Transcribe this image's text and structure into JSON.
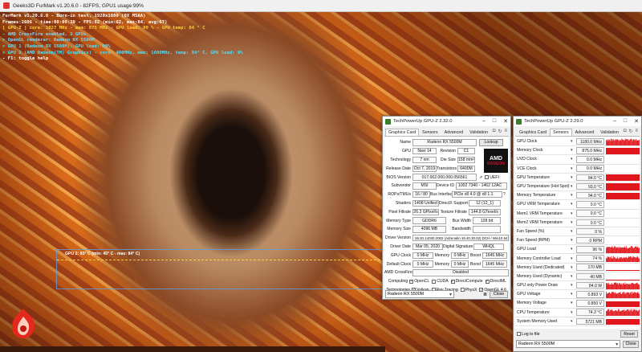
{
  "colors": {
    "graph_red": "#e0161c",
    "amd_red": "#c8102e",
    "info_yellow": "#ffd040",
    "info_cyan": "#4fe0ff"
  },
  "app": {
    "title": "Geeks3D FurMark v1.20.6.0 - 82FPS, GPU1 usage:99%"
  },
  "furmark_info": [
    {
      "text": "FurMark v1.20.6.0 - Burn-in test, 1920x1080 (0X MSAA)",
      "color": "w"
    },
    {
      "text": "Frames:2606 - time:00:00:30 - FPS:82 (min:62, max:84, avg:67)",
      "color": "w"
    },
    {
      "text": "[ GPU-Z ] core: 1027 MHz - mem: 875 MHz - GPU load: 99 % - GPU temp: 84 ° C",
      "color": "y"
    },
    {
      "text": "- AMD CrossFire enabled, 2 GPUs",
      "color": "lb"
    },
    {
      "text": "> OpenGL renderer: Radeon RX 5500M",
      "color": "lb"
    },
    {
      "text": "> GPU 1 (Radeon RX 5500M), GPU load: 99%",
      "color": "g"
    },
    {
      "text": "> GPU 2 (AMD Radeon(TM) Graphics) - core: 400MHz, mem: 1600MHz, temp: 84° C, GPU load: 0%",
      "color": "g"
    },
    {
      "text": "- F1: toggle help",
      "color": "w"
    }
  ],
  "temp_graph": {
    "label": "GPU 2: 83° C (min: 45° C - max: 84° C)"
  },
  "gpuz_card": {
    "title": "TechPowerUp GPU-Z 2.32.0",
    "tabs": [
      "Graphics Card",
      "Sensors",
      "Advanced",
      "Validation"
    ],
    "name": "Radeon RX 5500M",
    "lookup": "Lookup",
    "gpu": "Navi 14",
    "revision_lbl": "Revision",
    "revision": "C1",
    "technology": "7 nm",
    "die_size_lbl": "Die Size",
    "die_size": "158 mm²",
    "release_date": "Oct 7, 2019",
    "transistors_lbl": "Transistors",
    "transistors": "6400M",
    "bios": "017.002.000.000.056561",
    "uefi": "UEFI",
    "subvendor": "MSI",
    "device_id_lbl": "Device ID",
    "device_id": "1002 7340 - 1462 12AC",
    "rops": "16 / 80",
    "bus_lbl": "Bus Interface",
    "bus": "PCIe x8 4.0 @ x8 1.1",
    "shaders": "1408 Unified",
    "dx_lbl": "DirectX Support",
    "dx": "12 (12_1)",
    "pixel": "26.3 GPixel/s",
    "texture_lbl": "Texture Fillrate",
    "texture": "144.8 GTexel/s",
    "mem_type": "GDDR6",
    "buswidth_lbl": "Bus Width",
    "buswidth": "128 bit",
    "mem_size": "4096 MB",
    "bandwidth_lbl": "Bandwidth",
    "bandwidth": "",
    "driver": "26.20.14030.2002 (Adrenalin 19.40.30.02) DCH / Win10 64",
    "driver_date": "Mar 05, 2020",
    "sig_lbl": "Digital Signature",
    "sig": "WHQL",
    "gpu_clock": "0 MHz",
    "gc_mem": "0 MHz",
    "gc_boost": "1645 MHz",
    "def_clock": "0 MHz",
    "dc_mem": "0 MHz",
    "dc_boost": "1645 MHz",
    "crossfire": "Disabled",
    "computing": [
      "OpenCL",
      "CUDA",
      "DirectCompute",
      "DirectML"
    ],
    "computing_checked": [
      "✓",
      "",
      "✓",
      "✓"
    ],
    "technologies": [
      "Vulkan",
      "Ray Tracing",
      "PhysX",
      "OpenGL 4.6"
    ],
    "tech_checked": [
      "✓",
      "",
      "",
      "✓"
    ],
    "labels": {
      "name": "Name",
      "gpu": "GPU",
      "technology": "Technology",
      "release": "Release Date",
      "bios": "BIOS Version",
      "subvendor": "Subvendor",
      "rops": "ROPs/TMUs",
      "shaders": "Shaders",
      "pixel": "Pixel Fillrate",
      "mem_type": "Memory Type",
      "mem_size": "Memory Size",
      "driver": "Driver Version",
      "driver_date": "Driver Date",
      "gpu_clock": "GPU Clock",
      "def_clock": "Default Clock",
      "memory": "Memory",
      "boost": "Boost",
      "crossfire": "AMD CrossFire",
      "computing": "Computing",
      "technologies": "Technologies"
    },
    "gpu_select": "Radeon RX 5500M",
    "close": "Close"
  },
  "gpuz_sensors": {
    "title": "TechPowerUp GPU-Z 2.29.0",
    "tabs": [
      "Graphics Card",
      "Sensors",
      "Advanced",
      "Validation"
    ],
    "rows": [
      {
        "name": "GPU Clock",
        "value": "1180.0 MHz",
        "level": 0.85,
        "noisy": true
      },
      {
        "name": "Memory Clock",
        "value": "875.0 MHz",
        "level": 0.9,
        "noisy": false
      },
      {
        "name": "UVD Clock",
        "value": "0.0 MHz",
        "level": 0,
        "noisy": false
      },
      {
        "name": "VCE Clock",
        "value": "0.0 MHz",
        "level": 0,
        "noisy": false
      },
      {
        "name": "GPU Temperature",
        "value": "84.0 °C",
        "level": 0.9,
        "noisy": false
      },
      {
        "name": "GPU Temperature (Hot Spot)",
        "value": "93.0 °C",
        "level": 0.9,
        "noisy": false
      },
      {
        "name": "Memory Temperature",
        "value": "94.0 °C",
        "level": 0.9,
        "noisy": false
      },
      {
        "name": "GPU VRM Temperature",
        "value": "0.0 °C",
        "level": 0,
        "noisy": false
      },
      {
        "name": "Mem1 VRM Temperature",
        "value": "0.0 °C",
        "level": 0,
        "noisy": false
      },
      {
        "name": "Mem2 VRM Temperature",
        "value": "0.0 °C",
        "level": 0,
        "noisy": false
      },
      {
        "name": "Fan Speed (%)",
        "value": "0 %",
        "level": 0,
        "noisy": false
      },
      {
        "name": "Fan Speed (RPM)",
        "value": "0 RPM",
        "level": 0,
        "noisy": false
      },
      {
        "name": "GPU Load",
        "value": "96 %",
        "level": 0.9,
        "noisy": true
      },
      {
        "name": "Memory Controller Load",
        "value": "74 %",
        "level": 0.7,
        "noisy": true
      },
      {
        "name": "Memory Used (Dedicated)",
        "value": "170 MB",
        "level": 0.15,
        "noisy": false
      },
      {
        "name": "Memory Used (Dynamic)",
        "value": "40 MB",
        "level": 0.08,
        "noisy": false
      },
      {
        "name": "GPU only Power Draw",
        "value": "84.0 W",
        "level": 0.85,
        "noisy": true
      },
      {
        "name": "GPU Voltage",
        "value": "0.893 V",
        "level": 0.8,
        "noisy": true
      },
      {
        "name": "Memory Voltage",
        "value": "0.850 V",
        "level": 0.75,
        "noisy": false
      },
      {
        "name": "CPU Temperature",
        "value": "74.3 °C",
        "level": 0.85,
        "noisy": true
      },
      {
        "name": "System Memory Used",
        "value": "5721 MB",
        "level": 0.8,
        "noisy": false
      }
    ],
    "log": "Log to file",
    "reset": "Reset",
    "gpu_select": "Radeon RX 5500M",
    "close": "Close"
  }
}
